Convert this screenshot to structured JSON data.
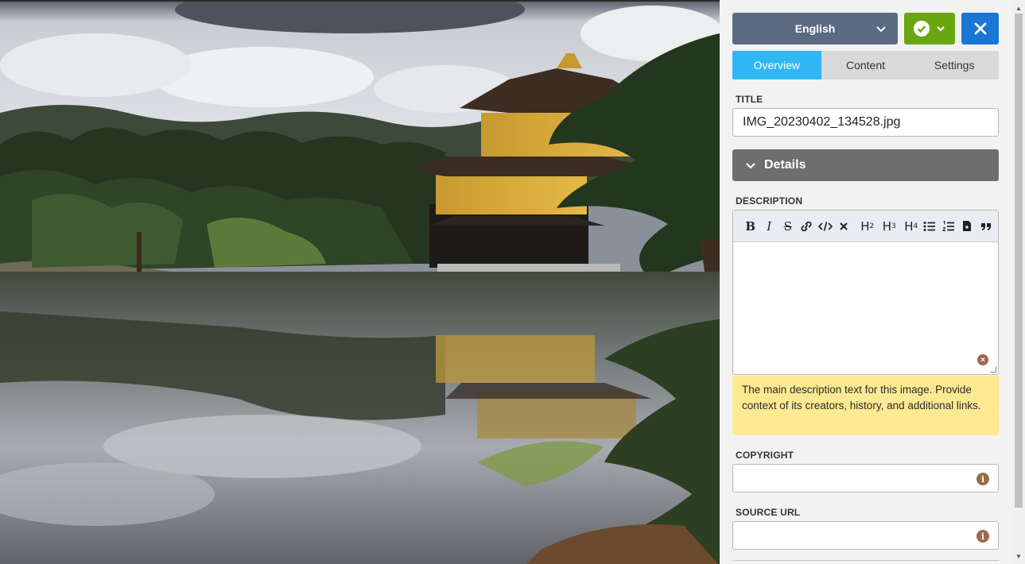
{
  "header": {
    "language": "English"
  },
  "tabs": [
    {
      "label": "Overview",
      "active": true
    },
    {
      "label": "Content",
      "active": false
    },
    {
      "label": "Settings",
      "active": false
    }
  ],
  "fields": {
    "title_label": "TITLE",
    "title_value": "IMG_20230402_134528.jpg",
    "details_label": "Details",
    "description_label": "DESCRIPTION",
    "description_help": "The main description text for this image. Provide context of its creators, history, and additional links.",
    "copyright_label": "COPYRIGHT",
    "copyright_value": "",
    "source_url_label": "SOURCE URL",
    "source_url_value": ""
  },
  "toolbar": {
    "bold": "B",
    "italic": "I",
    "strike": "S",
    "h2": "H",
    "h3": "H",
    "h4": "H",
    "h2_level": "2",
    "h3_level": "3",
    "h4_level": "4"
  },
  "colors": {
    "language_select": "#5c6a82",
    "save": "#6aa612",
    "close": "#1976d2",
    "tab_active": "#2fb7f5",
    "details_bar": "#6e6e6e",
    "help_box": "#fde992"
  }
}
